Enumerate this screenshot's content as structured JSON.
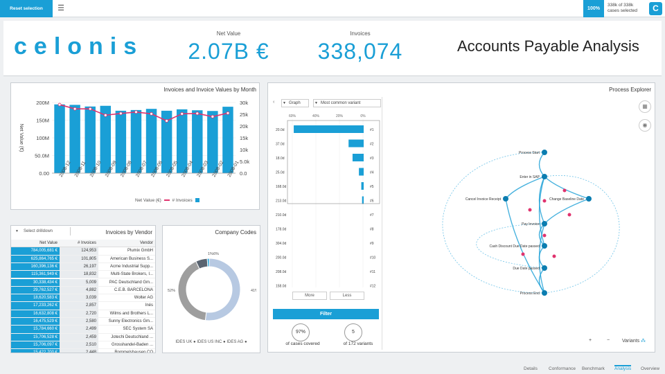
{
  "topbar": {
    "logo_letter": "C",
    "cases_line1": "338k of 338k",
    "cases_line2": "cases selected",
    "percent": "100%",
    "reset_label": "Reset selection",
    "menu_icon": "hamburger-icon"
  },
  "header": {
    "title": "Accounts Payable Analysis",
    "invoices_label": "Invoices",
    "invoices_value": "338,074",
    "netvalue_label": "Net Value",
    "netvalue_value": "2.07B €",
    "logo_text": "celonis"
  },
  "month_chart": {
    "title": "Invoices and Invoice Values by Month",
    "ylabel_left": "# Invoices",
    "ylabel_right": "Net Value (€)",
    "left_ticks": [
      "30k",
      "25k",
      "20k",
      "15k",
      "10k",
      "5.0k",
      "0.0"
    ],
    "right_ticks": [
      "200M",
      "150M",
      "100M",
      "50.0M",
      "0.00"
    ],
    "legend_invoices": "# Invoices",
    "legend_netvalue": "Net Value (€)"
  },
  "chart_data": {
    "type": "bar",
    "title": "Invoices and Invoice Values by Month",
    "categories": [
      "2008-01",
      "2008-02",
      "2008-03",
      "2008-04",
      "2008-05",
      "2008-06",
      "2008-07",
      "2008-08",
      "2008-09",
      "2008-10",
      "2008-11",
      "2008-12"
    ],
    "series": [
      {
        "name": "# Invoices",
        "type": "bar",
        "values": [
          28200,
          26400,
          26700,
          27100,
          26500,
          27300,
          26800,
          26500,
          28600,
          28300,
          29000,
          29200
        ]
      },
      {
        "name": "Net Value (€)",
        "type": "line",
        "values": [
          170000000,
          160000000,
          169000000,
          168000000,
          148000000,
          168000000,
          173000000,
          169000000,
          164000000,
          182000000,
          182000000,
          194000000
        ]
      }
    ],
    "ylim_invoices": [
      0,
      30000
    ],
    "ylim_netvalue": [
      0,
      200000000
    ]
  },
  "vendors": {
    "title": "Invoices by Vendor",
    "drilldown_label": "Select drilldown",
    "columns": [
      "Vendor",
      "# Invoices",
      "Net Value"
    ],
    "rows": [
      [
        "Plumix GmbH",
        "124,953",
        "784,005,681 €"
      ],
      [
        "American Business S...",
        "101,805",
        "625,864,765 €"
      ],
      [
        "Acme Industrial Supp...",
        "26,197",
        "160,396,136 €"
      ],
      [
        "Multi-State Brokers, I...",
        "18,832",
        "115,361,949 €"
      ],
      [
        "PAC Deutschland Gm...",
        "5,009",
        "30,338,434 €"
      ],
      [
        "C.E.B. BARCELONA",
        "4,882",
        "29,762,527 €"
      ],
      [
        "Wolter AG",
        "3,039",
        "18,620,583 €"
      ],
      [
        "Inés",
        "2,857",
        "17,233,262 €"
      ],
      [
        "Wilms and Brothers L...",
        "2,720",
        "16,632,808 €"
      ],
      [
        "Sunny Electronics Gm...",
        "2,580",
        "16,475,529 €"
      ],
      [
        "SEC System SA",
        "2,499",
        "15,784,660 €"
      ],
      [
        "Jotechi Deutschland ...",
        "2,459",
        "15,706,528 €"
      ],
      [
        "Grosshandel-Baden ...",
        "2,510",
        "15,706,097 €"
      ],
      [
        "Rommelshausen CO",
        "2,448",
        "15,422,700 €"
      ]
    ]
  },
  "company_codes": {
    "title": "Company Codes",
    "legend": [
      "IDES AG",
      "IDES US INC",
      "IDES UK"
    ],
    "label_a": "41%",
    "label_b": "52%",
    "label_c": "6%",
    "label_d": "1%"
  },
  "donut_data": {
    "values": [
      52,
      41,
      6,
      1
    ],
    "colors": [
      "#b7c9e2",
      "#9e9e9e",
      "#5a6470",
      "#1a9fd6"
    ]
  },
  "process_explorer": {
    "title": "Process Explorer",
    "variants_label": "Variants",
    "activities": [
      "Process Start",
      "Enter in SAP",
      "Change Baseline Date",
      "Cancel Invoice Receipt",
      "Pay Invoice",
      "Cash Discount Due Date passed",
      "Due Date passed",
      "Process End"
    ]
  },
  "variant_panel": {
    "dropdown_label": "Most common variant",
    "graph_label": "Graph",
    "pct_headers": [
      "60%",
      "40%",
      "20%",
      "0%"
    ],
    "rows": [
      {
        "label": "#1",
        "days": "20.0d",
        "value": 0.88
      },
      {
        "label": "#2",
        "days": "37.0d",
        "value": 0.19
      },
      {
        "label": "#3",
        "days": "18.0d",
        "value": 0.14
      },
      {
        "label": "#4",
        "days": "25.0d",
        "value": 0.06
      },
      {
        "label": "#5",
        "days": "168.0d",
        "value": 0.03
      },
      {
        "label": "#6",
        "days": "213.0d",
        "value": 0.02
      },
      {
        "label": "#7",
        "days": "210.0d",
        "value": 0.0
      },
      {
        "label": "#8",
        "days": "178.0d",
        "value": 0.0
      },
      {
        "label": "#9",
        "days": "304.0d",
        "value": 0.0
      },
      {
        "label": "#10",
        "days": "200.0d",
        "value": 0.0
      },
      {
        "label": "#11",
        "days": "208.0d",
        "value": 0.0
      },
      {
        "label": "#12",
        "days": "158.0d",
        "value": 0.0
      }
    ],
    "less_label": "Less",
    "more_label": "More",
    "filter_label": "Filter",
    "variants_count": "5",
    "of_variants": "of 172 variants",
    "cases_pct": "97%",
    "of_cases": "of cases covered"
  },
  "tabs": [
    "Overview",
    "Analysis",
    "Benchmark",
    "Conformance",
    "Details"
  ]
}
